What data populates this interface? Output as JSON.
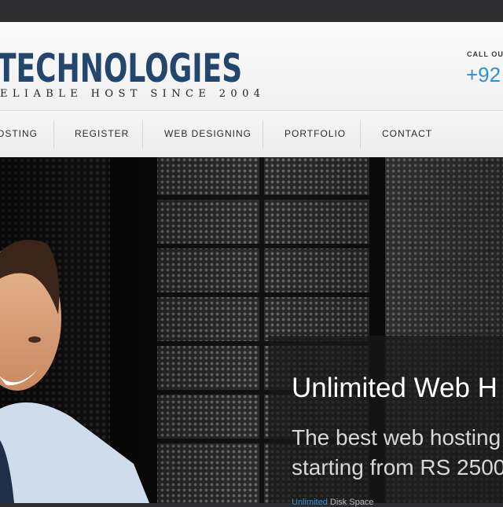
{
  "header": {
    "logo_title": "TECHNOLOGIES",
    "logo_tagline": "ELIABLE HOST SINCE 2004",
    "call_label": "CALL OU",
    "phone": "+92"
  },
  "nav": {
    "items": [
      {
        "label": "OSTING"
      },
      {
        "label": "REGISTER"
      },
      {
        "label": "WEB DESIGNING"
      },
      {
        "label": "PORTFOLIO"
      },
      {
        "label": "CONTACT"
      }
    ]
  },
  "hero": {
    "title": "Unlimited Web H",
    "subtitle": "The best web hosting\nstarting from RS 2500",
    "feature_highlight": "Unlimited",
    "feature_text": " Disk Space"
  },
  "colors": {
    "brand_navy": "#23466d",
    "accent_blue": "#2f8fd8",
    "nav_bg": "#f0f0f0"
  }
}
